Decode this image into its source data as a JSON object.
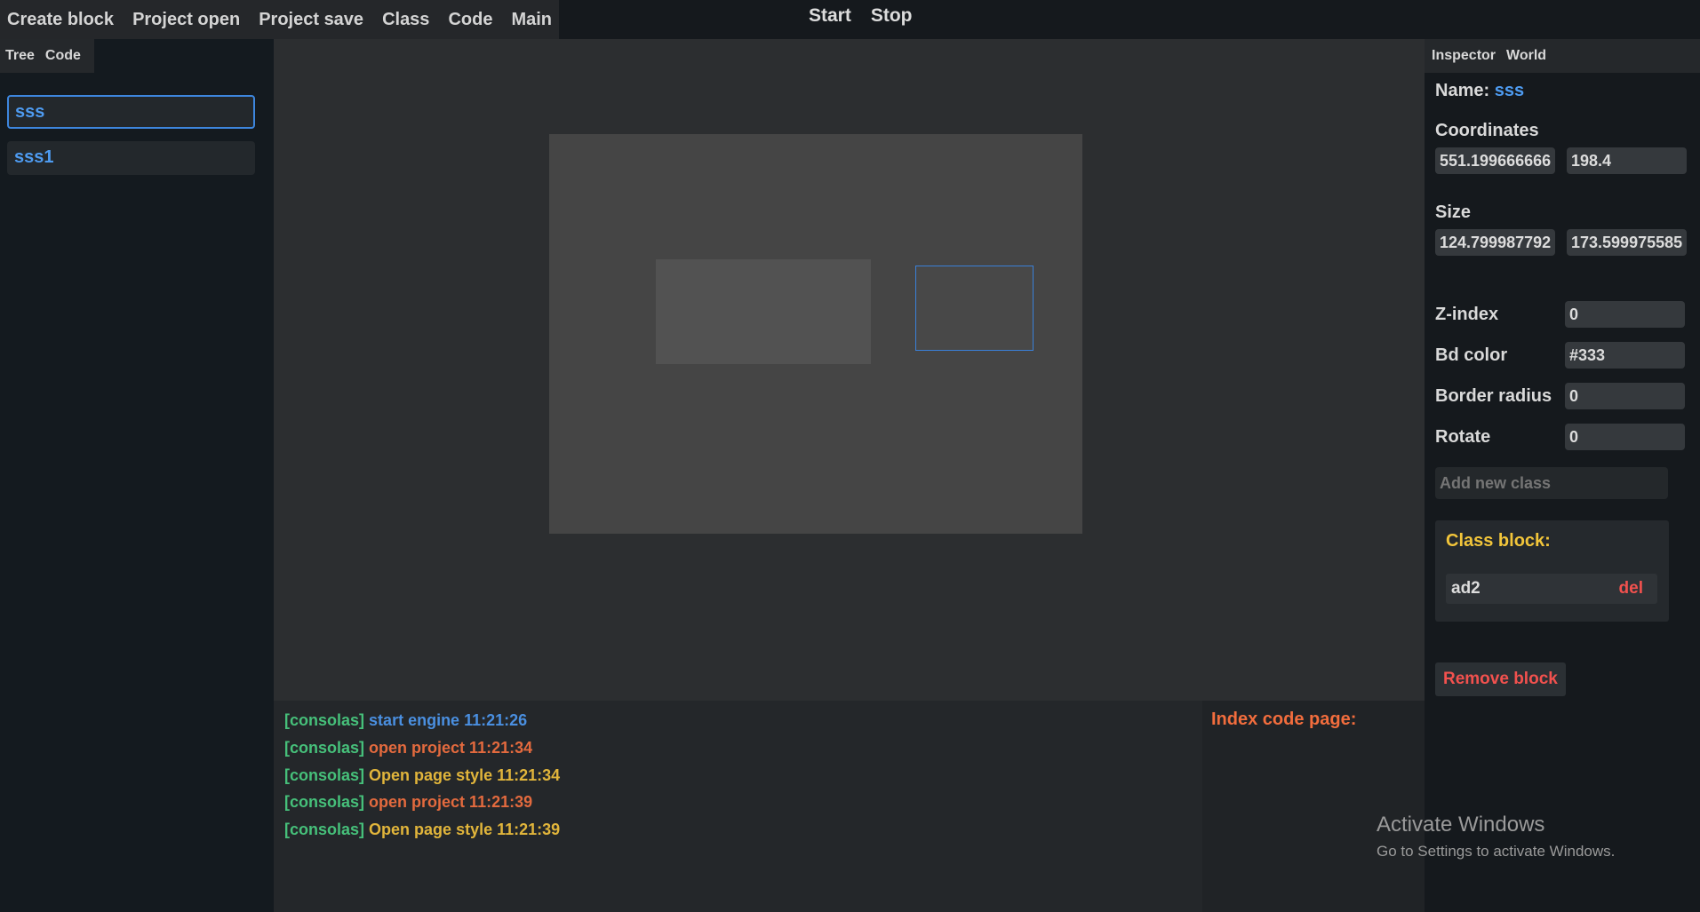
{
  "menu": {
    "items": [
      "Create block",
      "Project open",
      "Project save",
      "Class",
      "Code",
      "Main"
    ],
    "run": [
      "Start",
      "Stop"
    ]
  },
  "left_panel": {
    "tabs": [
      "Tree",
      "Code"
    ],
    "tree_items": [
      {
        "label": "sss",
        "selected": true
      },
      {
        "label": "sss1",
        "selected": false
      }
    ]
  },
  "console": {
    "lines": [
      {
        "tag": "[consolas]",
        "text": "start engine 11:21:26",
        "color": "#4a8fe0"
      },
      {
        "tag": "[consolas]",
        "text": "open project 11:21:34",
        "color": "#e36a3e"
      },
      {
        "tag": "[consolas]",
        "text": "Open page style 11:21:34",
        "color": "#e1b53b"
      },
      {
        "tag": "[consolas]",
        "text": "open project 11:21:39",
        "color": "#e36a3e"
      },
      {
        "tag": "[consolas]",
        "text": "Open page style 11:21:39",
        "color": "#e1b53b"
      }
    ],
    "tag_color": "#46c07a"
  },
  "code_page": {
    "title": "Index code page:"
  },
  "inspector": {
    "tabs": [
      "Inspector",
      "World"
    ],
    "name_label": "Name:",
    "name_value": "sss",
    "coordinates_label": "Coordinates",
    "coord_x": "551.1996666666",
    "coord_y": "198.4",
    "size_label": "Size",
    "size_w": "124.7999877929",
    "size_h": "173.5999755859",
    "z_index_label": "Z-index",
    "z_index": "0",
    "bd_color_label": "Bd color",
    "bd_color": "#333",
    "border_radius_label": "Border radius",
    "border_radius": "0",
    "rotate_label": "Rotate",
    "rotate": "0",
    "add_class_placeholder": "Add new class",
    "class_block_title": "Class block:",
    "class_name": "ad2",
    "class_del": "del",
    "remove_button": "Remove block"
  },
  "watermark": {
    "title": "Activate Windows",
    "subtitle": "Go to Settings to activate Windows."
  },
  "colors": {
    "accent_blue": "#4e9bf0",
    "class_title_yellow": "#f2c53a",
    "danger_red": "#f2514e"
  }
}
